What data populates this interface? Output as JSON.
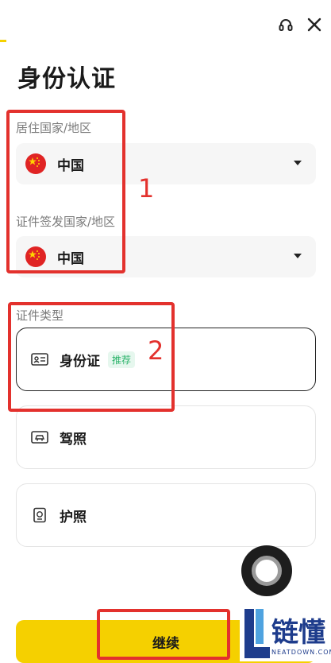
{
  "header": {
    "support_icon": "headset-icon",
    "close_icon": "close-icon"
  },
  "page": {
    "title": "身份认证"
  },
  "residence": {
    "label": "居住国家/地区",
    "value": "中国",
    "flag_icon": "china-flag-icon"
  },
  "issuing": {
    "label": "证件签发国家/地区",
    "value": "中国",
    "flag_icon": "china-flag-icon"
  },
  "doc_type": {
    "label": "证件类型",
    "options": [
      {
        "label": "身份证",
        "badge": "推荐",
        "icon": "id-card-icon",
        "selected": true
      },
      {
        "label": "驾照",
        "badge": "",
        "icon": "car-icon",
        "selected": false
      },
      {
        "label": "护照",
        "badge": "",
        "icon": "passport-icon",
        "selected": false
      }
    ]
  },
  "annotations": {
    "num1": "1",
    "num2": "2"
  },
  "footer": {
    "continue_label": "继续"
  },
  "watermark": {
    "title": "链懂",
    "subtitle": "NEATDOWN.COM"
  },
  "colors": {
    "accent": "#f5d000",
    "annotation_red": "#e3312d",
    "flag_red": "#e02424",
    "badge_green": "#2bb36a"
  }
}
